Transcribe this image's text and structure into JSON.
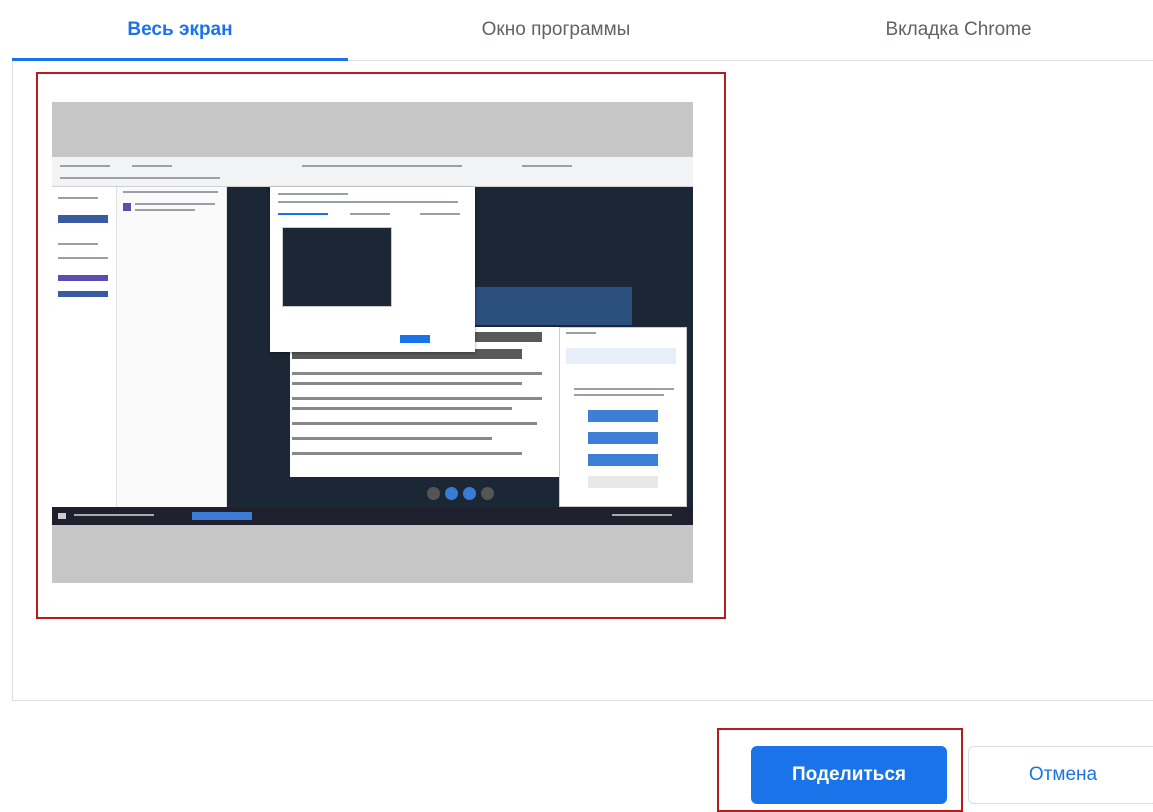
{
  "tabs": [
    {
      "label": "Весь экран",
      "active": true
    },
    {
      "label": "Окно программы",
      "active": false
    },
    {
      "label": "Вкладка Chrome",
      "active": false
    }
  ],
  "buttons": {
    "share_label": "Поделиться",
    "cancel_label": "Отмена"
  },
  "colors": {
    "accent": "#1a73e8",
    "highlight_border": "#b71c1c",
    "tab_inactive": "#5f6368",
    "divider": "#dadce0"
  }
}
